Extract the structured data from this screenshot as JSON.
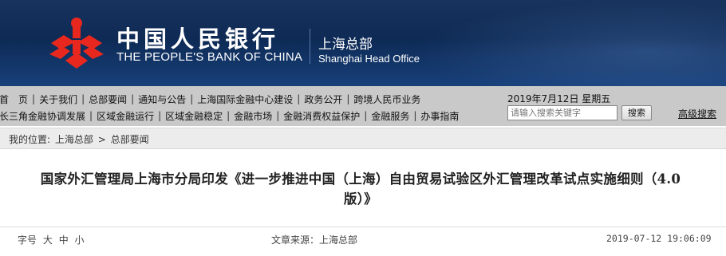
{
  "header": {
    "logo_cn": "中国人民银行",
    "logo_en": "THE PEOPLE'S BANK OF CHINA",
    "branch_cn": "上海总部",
    "branch_en": "Shanghai Head Office",
    "logo_icon": "pboc-emblem-icon",
    "logo_color": "#e8281e"
  },
  "nav": {
    "row1": [
      "首　页",
      "关于我们",
      "总部要闻",
      "通知与公告",
      "上海国际金融中心建设",
      "政务公开",
      "跨境人民币业务"
    ],
    "row2": [
      "长三角金融协调发展",
      "区域金融运行",
      "区域金融稳定",
      "金融市场",
      "金融消费权益保护",
      "金融服务",
      "办事指南"
    ],
    "date": "2019年7月12日  星期五",
    "search_placeholder": "请输入搜索关键字",
    "search_button": "搜索",
    "advanced_search": "高级搜索"
  },
  "breadcrumb": {
    "prefix": "我的位置:",
    "items": [
      "上海总部",
      "总部要闻"
    ],
    "separator": ">"
  },
  "article": {
    "title_line1": "国家外汇管理局上海市分局印发《进一步推进中国（上海）自由贸易试验区外汇管理改革试点实施细则（4.0",
    "title_line2": "版）》",
    "font_size_label": "字号",
    "font_sizes": [
      "大",
      "中",
      "小"
    ],
    "source": "文章来源：上海总部",
    "published": "2019-07-12 19:06:09"
  }
}
